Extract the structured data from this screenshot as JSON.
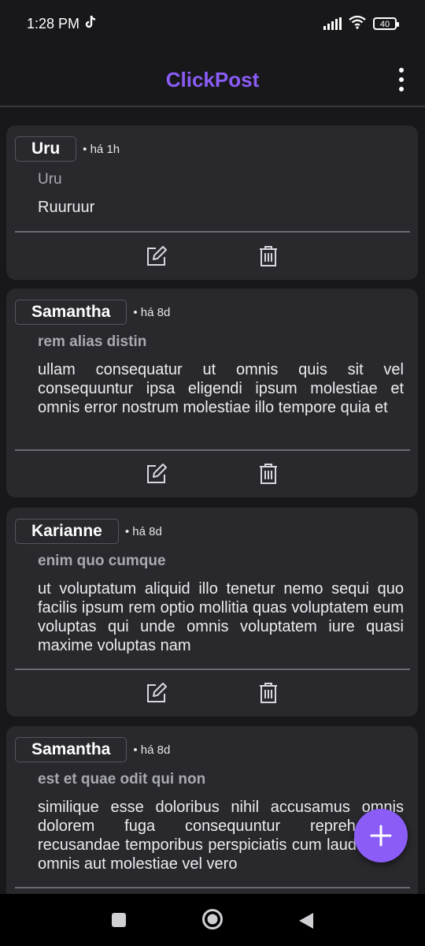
{
  "status_bar": {
    "time": "1:28 PM",
    "battery": "40",
    "icons": [
      "tiktok-icon",
      "signal-icon",
      "wifi-icon",
      "battery-icon"
    ]
  },
  "app": {
    "title": "ClickPost",
    "accent_color": "#8b5cf6",
    "menu_icon": "more-vert-icon"
  },
  "posts": [
    {
      "author": "Uru",
      "time": "• há 1h",
      "title": "Uru",
      "body": "Ruuruur",
      "edit_icon": "edit-icon",
      "delete_icon": "trash-icon"
    },
    {
      "author": "Samantha",
      "time": "• há 8d",
      "title": "rem alias distin",
      "body": "ullam consequatur ut omnis quis sit vel consequuntur ipsa eligendi ipsum molestiae et omnis error nostrum molestiae illo tempore quia et",
      "edit_icon": "edit-icon",
      "delete_icon": "trash-icon"
    },
    {
      "author": "Karianne",
      "time": "• há 8d",
      "title": "enim quo cumque",
      "body": "ut voluptatum aliquid illo tenetur nemo sequi quo facilis ipsum rem optio mollitia quas voluptatem eum voluptas qui unde omnis voluptatem iure quasi maxime voluptas nam",
      "edit_icon": "edit-icon",
      "delete_icon": "trash-icon"
    },
    {
      "author": "Samantha",
      "time": "• há 8d",
      "title": "est et quae odit qui non",
      "body": "similique esse doloribus nihil accusamus omnis dolorem fuga consequuntur reprehenderit recusandae temporibus perspiciatis cum laudantium omnis aut molestiae vel vero",
      "edit_icon": "edit-icon",
      "delete_icon": "trash-icon"
    }
  ],
  "fab": {
    "icon": "plus-icon"
  },
  "nav_bar": {
    "icons": [
      "recents-square-icon",
      "home-circle-icon",
      "back-triangle-icon"
    ]
  }
}
